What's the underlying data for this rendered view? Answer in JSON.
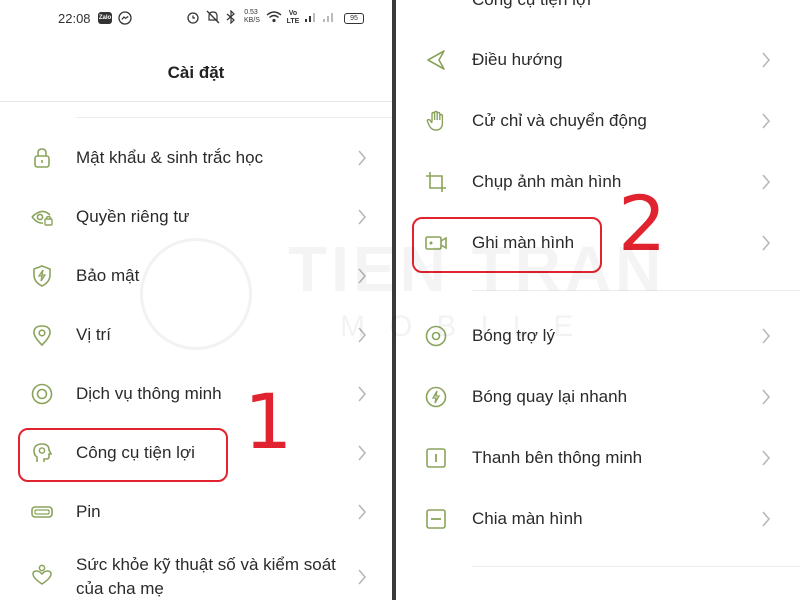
{
  "status_bar": {
    "time": "22:08",
    "zalo": "Zalo",
    "net_speed_value": "0.53",
    "net_speed_unit": "KB/S",
    "volte": "Vo LTE",
    "battery": "95"
  },
  "left": {
    "title": "Cài đặt",
    "items": [
      {
        "label": "Mật khẩu & sinh trắc học",
        "icon": "lock-icon"
      },
      {
        "label": "Quyền riêng tư",
        "icon": "eye-lock-icon"
      },
      {
        "label": "Bảo mật",
        "icon": "shield-bolt-icon"
      },
      {
        "label": "Vị trí",
        "icon": "location-pin-icon"
      },
      {
        "label": "Dịch vụ thông minh",
        "icon": "smart-services-icon"
      },
      {
        "label": "Công cụ tiện lợi",
        "icon": "convenience-tools-icon"
      },
      {
        "label": "Pin",
        "icon": "battery-icon"
      },
      {
        "label": "Sức khỏe kỹ thuật số và kiểm soát của cha mẹ",
        "icon": "digital-wellbeing-icon"
      }
    ]
  },
  "right": {
    "cut_top_label": "Công cụ tiện lợi",
    "items": [
      {
        "label": "Điều hướng",
        "icon": "navigation-icon"
      },
      {
        "label": "Cử chỉ và chuyển động",
        "icon": "hand-gesture-icon"
      },
      {
        "label": "Chụp ảnh màn hình",
        "icon": "crop-icon"
      },
      {
        "label": "Ghi màn hình",
        "icon": "screen-record-icon"
      },
      {
        "label": "Bóng trợ lý",
        "icon": "assistant-ball-icon"
      },
      {
        "label": "Bóng quay lại nhanh",
        "icon": "quick-return-icon"
      },
      {
        "label": "Thanh bên thông minh",
        "icon": "smart-sidebar-icon"
      },
      {
        "label": "Chia màn hình",
        "icon": "split-screen-icon"
      }
    ]
  },
  "steps": {
    "one": "1",
    "two": "2"
  },
  "watermark": {
    "main": "TIEN TRAN",
    "sub": "MOBILE"
  },
  "colors": {
    "icon": "#8aa35c",
    "highlight": "#e0232f",
    "chevron": "#b8b8b8"
  }
}
